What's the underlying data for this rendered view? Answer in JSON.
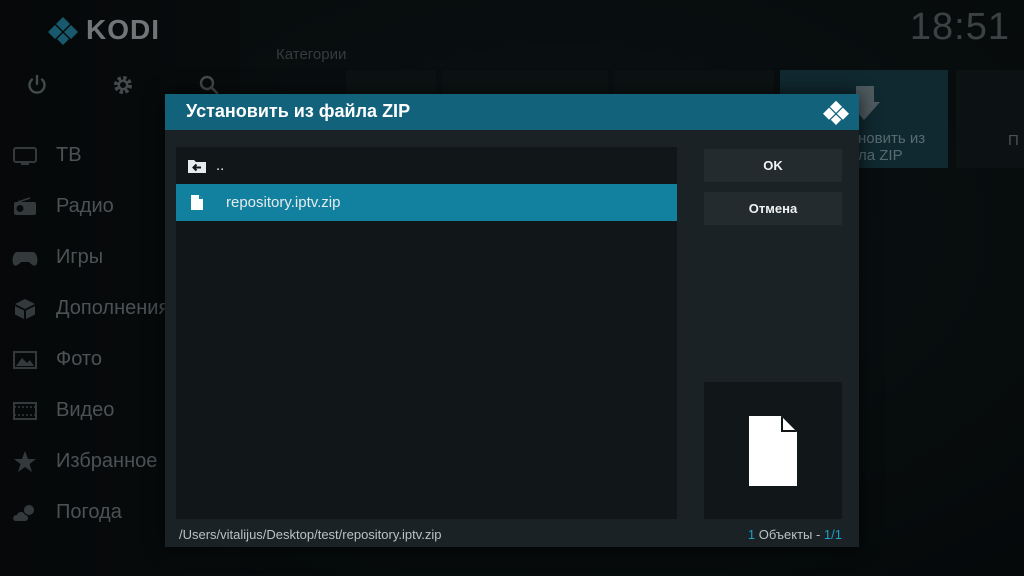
{
  "app": {
    "name": "KODI",
    "clock": "18:51"
  },
  "home": {
    "category_label": "Категории",
    "top_icons": [
      "power-icon",
      "gear-icon",
      "search-icon"
    ],
    "menu": [
      {
        "label": "ТВ",
        "icon": "tv-icon"
      },
      {
        "label": "Радио",
        "icon": "radio-icon"
      },
      {
        "label": "Игры",
        "icon": "gamepad-icon"
      },
      {
        "label": "Дополнения",
        "icon": "addons-box-icon"
      },
      {
        "label": "Фото",
        "icon": "photo-icon"
      },
      {
        "label": "Видео",
        "icon": "film-icon"
      },
      {
        "label": "Избранное",
        "icon": "star-icon"
      },
      {
        "label": "Погода",
        "icon": "weather-icon"
      }
    ],
    "selected_tile": {
      "line1": "новить из",
      "line2": "ла ZIP"
    },
    "right_tile": {
      "text": "П"
    }
  },
  "dialog": {
    "title": "Установить из файла ZIP",
    "files": [
      {
        "label": "..",
        "icon": "parent-folder-icon"
      },
      {
        "label": "repository.iptv.zip",
        "icon": "file-icon",
        "selected": true
      }
    ],
    "buttons": {
      "ok": "OK",
      "cancel": "Отмена"
    },
    "path": "/Users/vitalijus/Desktop/test/repository.iptv.zip",
    "count": {
      "items": "1",
      "label": " Объекты - ",
      "page": "1/1"
    }
  },
  "colors": {
    "accent": "#12819f",
    "header": "#12627c",
    "highlight_text": "#1e9fc4"
  }
}
